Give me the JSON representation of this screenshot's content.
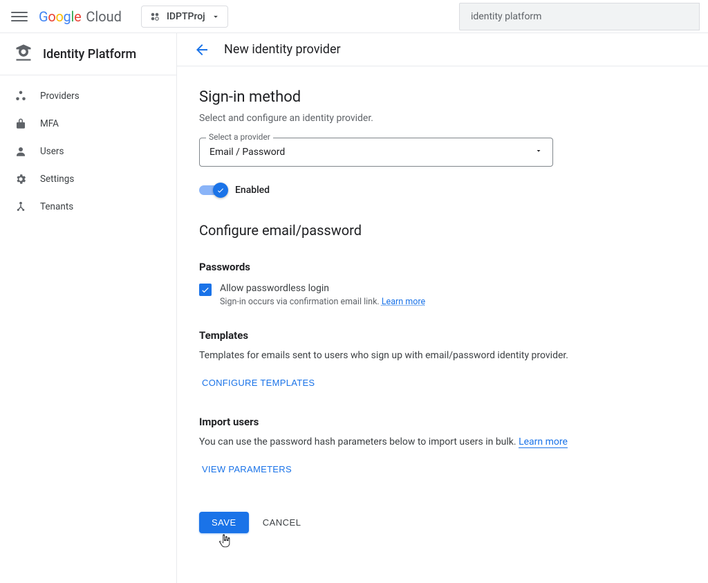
{
  "header": {
    "project_name": "IDPTProj",
    "search_value": "identity platform"
  },
  "sidebar": {
    "product_title": "Identity Platform",
    "items": [
      {
        "label": "Providers"
      },
      {
        "label": "MFA"
      },
      {
        "label": "Users"
      },
      {
        "label": "Settings"
      },
      {
        "label": "Tenants"
      }
    ]
  },
  "page": {
    "title": "New identity provider",
    "section_title": "Sign-in method",
    "section_sub": "Select and configure an identity provider.",
    "select_label": "Select a provider",
    "select_value": "Email / Password",
    "enabled_label": "Enabled",
    "config_title": "Configure email/password",
    "passwords_title": "Passwords",
    "passwordless_label": "Allow passwordless login",
    "passwordless_help": "Sign-in occurs via confirmation email link. ",
    "learn_more": "Learn more",
    "templates_title": "Templates",
    "templates_desc": "Templates for emails sent to users who sign up with email/password identity provider.",
    "configure_templates_btn": "CONFIGURE TEMPLATES",
    "import_title": "Import users",
    "import_desc": "You can use the password hash parameters below to import users in bulk. ",
    "view_params_btn": "VIEW PARAMETERS",
    "save_btn": "SAVE",
    "cancel_btn": "CANCEL"
  }
}
